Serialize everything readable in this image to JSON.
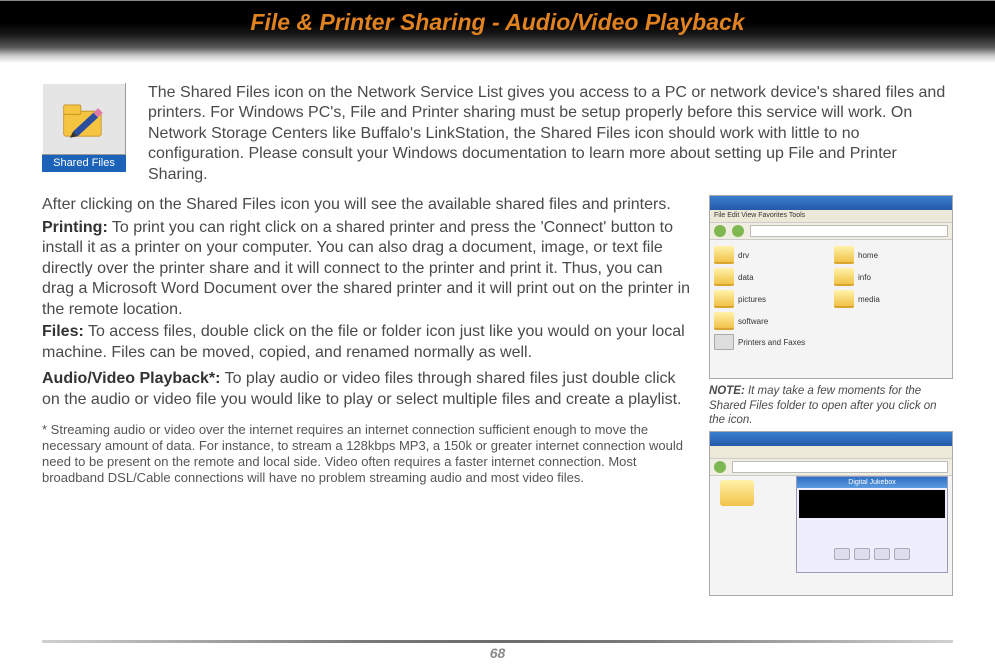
{
  "header": {
    "title": "File & Printer Sharing - Audio/Video Playback"
  },
  "icon": {
    "label": "Shared Files"
  },
  "intro": "The Shared Files icon on the Network Service List gives you access to a PC or network device's shared files and printers.  For Windows PC's, File and Printer sharing must be setup properly before this service will work.  On Network Storage Centers like Buffalo's LinkStation, the Shared Files icon should work with little to no configuration.  Please consult your Windows documentation to learn more about setting up File and Printer Sharing.",
  "body": {
    "p1": "After clicking on the Shared Files icon you will see the available shared files and printers.",
    "printing_label": "Printing:",
    "printing": "  To print you can right click on a shared printer and press the 'Connect' button to install it as a printer on your computer.  You can also drag a document, image, or text file directly over the printer share and it will connect to the printer and print it.  Thus, you can drag a Microsoft Word Document over the shared printer and it will print out on the printer in the remote location.",
    "files_label": "Files:",
    "files": "  To access files, double click on the file or folder icon just like you would on your local machine.  Files can be moved, copied, and renamed normally as well.",
    "av_label": "Audio/Video Playback*:",
    "av": "  To play audio or video files through shared files just double click on the audio or video file you would like to play or select multiple files and create a playlist."
  },
  "note": {
    "label": "NOTE:",
    "text": "  It may take a few moments for the Shared Files folder to open after you click on the icon."
  },
  "footnote": "* Streaming audio or video over the internet requires an internet connection sufficient enough to move the necessary amount of data.  For instance, to stream a 128kbps MP3, a 150k or greater internet connection would need to be present on the remote and local side.  Video often requires a faster internet connection.  Most broadband DSL/Cable connections will have no problem streaming audio and most video files.",
  "screenshot1": {
    "menu": "File  Edit  View  Favorites  Tools",
    "items": [
      "drv",
      "home",
      "data",
      "info",
      "pictures",
      "media",
      "software"
    ],
    "printers": "Printers and Faxes"
  },
  "screenshot2": {
    "player_title": "Digital Jukebox"
  },
  "page_number": "68"
}
